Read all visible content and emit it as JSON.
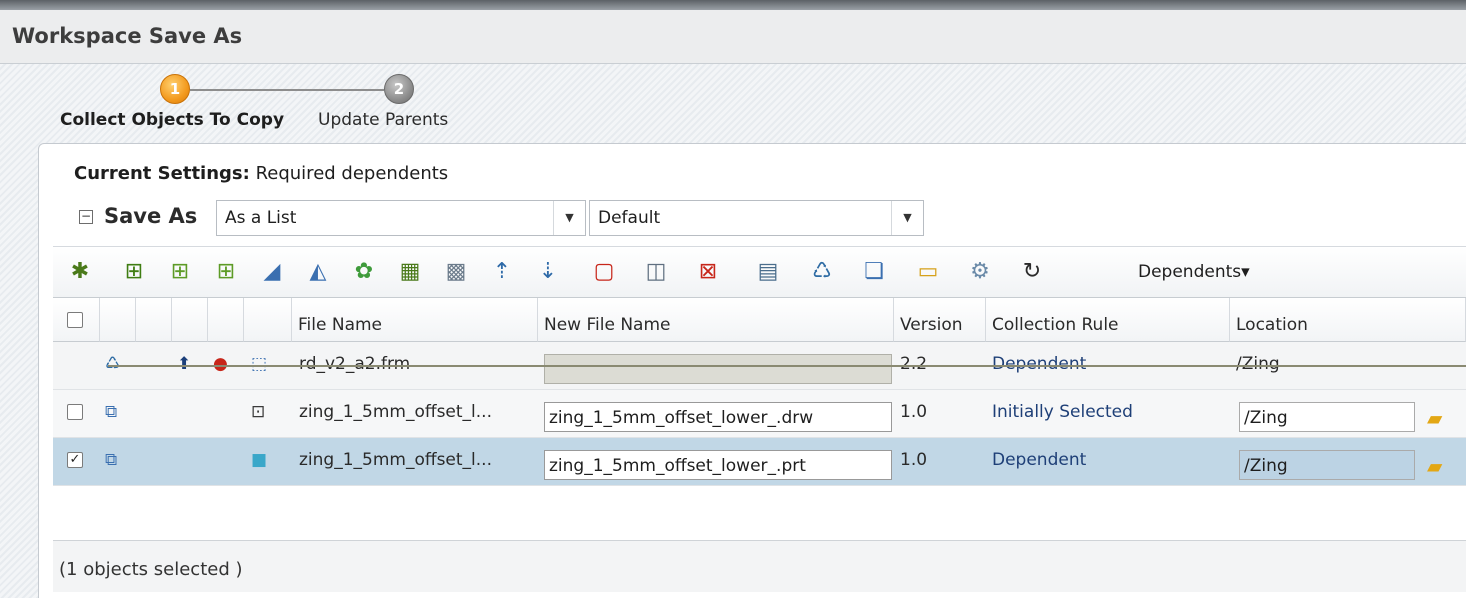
{
  "window": {
    "title": "Workspace Save As"
  },
  "stepper": {
    "steps": [
      {
        "number": "1",
        "label": "Collect Objects To Copy"
      },
      {
        "number": "2",
        "label": "Update Parents"
      }
    ]
  },
  "settings": {
    "label": "Current Settings:",
    "value": "Required dependents"
  },
  "save_as": {
    "label": "Save As",
    "collapse_glyph": "⊟",
    "mode_value": "As a List",
    "profile_value": "Default",
    "dropdown_glyph": "▼"
  },
  "toolbar": {
    "dependents_label": "Dependents",
    "dependents_arrow": "▾",
    "icons": [
      "gear-settings-icon",
      "add-object-icon",
      "add-parent-icon",
      "add-child-icon",
      "add-drawing-icon",
      "sketch-icon",
      "transform-icon",
      "table-icon",
      "grid-image-icon",
      "tree-up-icon",
      "tree-down-icon",
      "new-object-icon",
      "bracket-icon",
      "remove-icon",
      "list-icon",
      "recycle-icon",
      "copy-icon",
      "folder-icon",
      "settings-small-icon",
      "refresh-icon"
    ]
  },
  "table": {
    "columns": [
      "File Name",
      "New File Name",
      "Version",
      "Collection Rule",
      "Location"
    ],
    "rows": [
      {
        "file_name": "rd_v2_a2.frm",
        "new_file_name": "",
        "version": "2.2",
        "collection_rule": "Dependent",
        "location": "/Zing",
        "checked": false,
        "excluded": true
      },
      {
        "file_name": "zing_1_5mm_offset_l...",
        "new_file_name": "zing_1_5mm_offset_lower_.drw",
        "version": "1.0",
        "collection_rule": "Initially Selected",
        "location": "/Zing",
        "checked": false,
        "excluded": false
      },
      {
        "file_name": "zing_1_5mm_offset_l...",
        "new_file_name": "zing_1_5mm_offset_lower_.prt",
        "version": "1.0",
        "collection_rule": "Dependent",
        "location": "/Zing",
        "checked": true,
        "excluded": false
      }
    ],
    "check_glyph": "✓"
  },
  "status": {
    "text": "(1 objects selected )"
  },
  "colors": {
    "accent": "#f39a1e",
    "selected_row": "#c1d7e6",
    "rule_text": "#1e3f77"
  }
}
